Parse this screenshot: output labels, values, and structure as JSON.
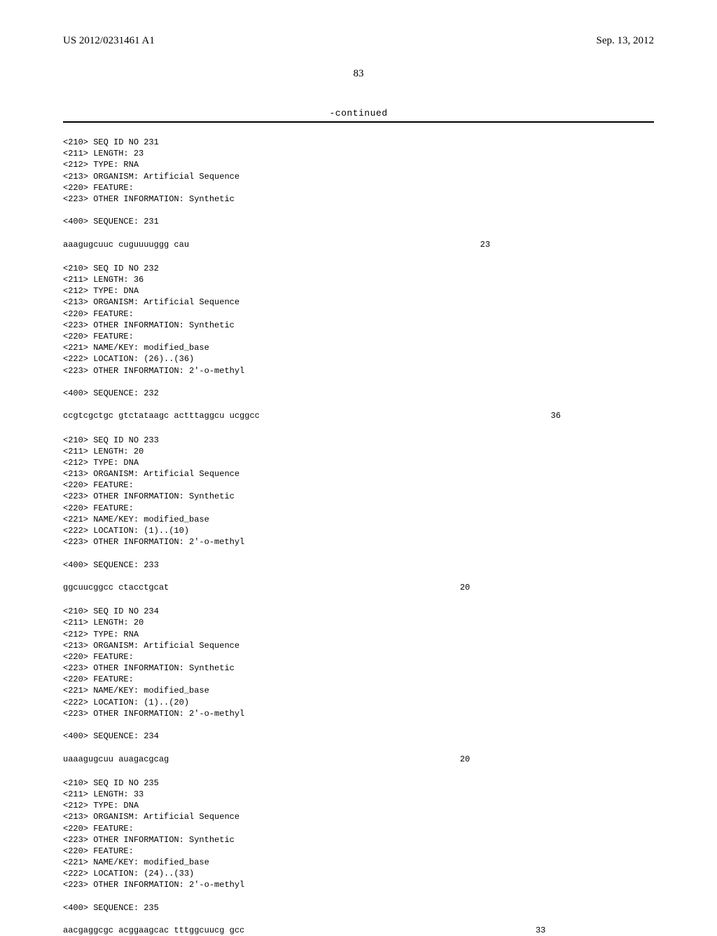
{
  "header": {
    "pub_number": "US 2012/0231461 A1",
    "pub_date": "Sep. 13, 2012"
  },
  "page_number": "83",
  "continued_label": "-continued",
  "entries": [
    {
      "meta": [
        "<210> SEQ ID NO 231",
        "<211> LENGTH: 23",
        "<212> TYPE: RNA",
        "<213> ORGANISM: Artificial Sequence",
        "<220> FEATURE:",
        "<223> OTHER INFORMATION: Synthetic"
      ],
      "seq_label": "<400> SEQUENCE: 231",
      "sequence": "aaagugcuuc cuguuuuggg cau",
      "length": "23"
    },
    {
      "meta": [
        "<210> SEQ ID NO 232",
        "<211> LENGTH: 36",
        "<212> TYPE: DNA",
        "<213> ORGANISM: Artificial Sequence",
        "<220> FEATURE:",
        "<223> OTHER INFORMATION: Synthetic",
        "<220> FEATURE:",
        "<221> NAME/KEY: modified_base",
        "<222> LOCATION: (26)..(36)",
        "<223> OTHER INFORMATION: 2'-o-methyl"
      ],
      "seq_label": "<400> SEQUENCE: 232",
      "sequence": "ccgtcgctgc gtctataagc actttaggcu ucggcc",
      "length": "36"
    },
    {
      "meta": [
        "<210> SEQ ID NO 233",
        "<211> LENGTH: 20",
        "<212> TYPE: DNA",
        "<213> ORGANISM: Artificial Sequence",
        "<220> FEATURE:",
        "<223> OTHER INFORMATION: Synthetic",
        "<220> FEATURE:",
        "<221> NAME/KEY: modified_base",
        "<222> LOCATION: (1)..(10)",
        "<223> OTHER INFORMATION: 2'-o-methyl"
      ],
      "seq_label": "<400> SEQUENCE: 233",
      "sequence": "ggcuucggcc ctacctgcat",
      "length": "20"
    },
    {
      "meta": [
        "<210> SEQ ID NO 234",
        "<211> LENGTH: 20",
        "<212> TYPE: RNA",
        "<213> ORGANISM: Artificial Sequence",
        "<220> FEATURE:",
        "<223> OTHER INFORMATION: Synthetic",
        "<220> FEATURE:",
        "<221> NAME/KEY: modified_base",
        "<222> LOCATION: (1)..(20)",
        "<223> OTHER INFORMATION: 2'-o-methyl"
      ],
      "seq_label": "<400> SEQUENCE: 234",
      "sequence": "uaaagugcuu auagacgcag",
      "length": "20"
    },
    {
      "meta": [
        "<210> SEQ ID NO 235",
        "<211> LENGTH: 33",
        "<212> TYPE: DNA",
        "<213> ORGANISM: Artificial Sequence",
        "<220> FEATURE:",
        "<223> OTHER INFORMATION: Synthetic",
        "<220> FEATURE:",
        "<221> NAME/KEY: modified_base",
        "<222> LOCATION: (24)..(33)",
        "<223> OTHER INFORMATION: 2'-o-methyl"
      ],
      "seq_label": "<400> SEQUENCE: 235",
      "sequence": "aacgaggcgc acggaagcac tttggcuucg gcc",
      "length": "33"
    }
  ]
}
